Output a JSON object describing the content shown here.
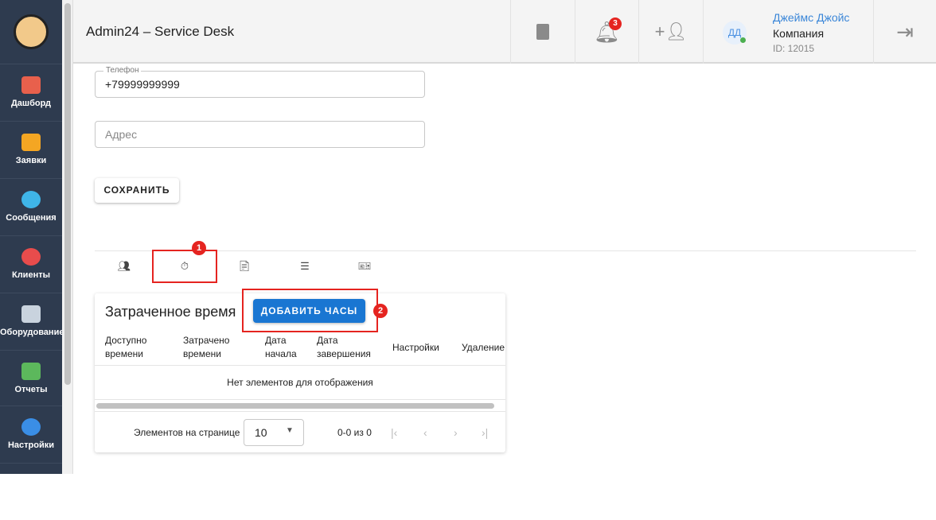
{
  "sidebar": {
    "items": [
      {
        "label": "Дашборд",
        "color": "#e8604c"
      },
      {
        "label": "Заявки",
        "color": "#f4a623"
      },
      {
        "label": "Сообщения",
        "color": "#3fb5e8"
      },
      {
        "label": "Клиенты",
        "color": "#e84c4c"
      },
      {
        "label": "Оборудование",
        "color": "#9ab"
      },
      {
        "label": "Отчеты",
        "color": "#5cb85c"
      },
      {
        "label": "Настройки",
        "color": "#3a8ee6"
      }
    ]
  },
  "header": {
    "title": "Admin24 – Service Desk",
    "notifications": "3",
    "avatar": "ДД",
    "user_name": "Джеймс Джойс",
    "company": "Компания",
    "user_id": "ID: 12015"
  },
  "form": {
    "phone_label": "Телефон",
    "phone_value": "+79999999999",
    "address_placeholder": "Адрес",
    "save": "СОХРАНИТЬ"
  },
  "annotations": [
    "1",
    "2"
  ],
  "card": {
    "title": "Затраченное время",
    "add_button": "ДОБАВИТЬ ЧАСЫ",
    "columns": [
      "Доступно времени",
      "Затрачено времени",
      "Дата начала",
      "Дата завершения",
      "Настройки",
      "Удаление"
    ],
    "empty": "Нет элементов для отображения",
    "per_page_label": "Элементов на странице",
    "per_page": "10",
    "range": "0-0 из 0"
  }
}
